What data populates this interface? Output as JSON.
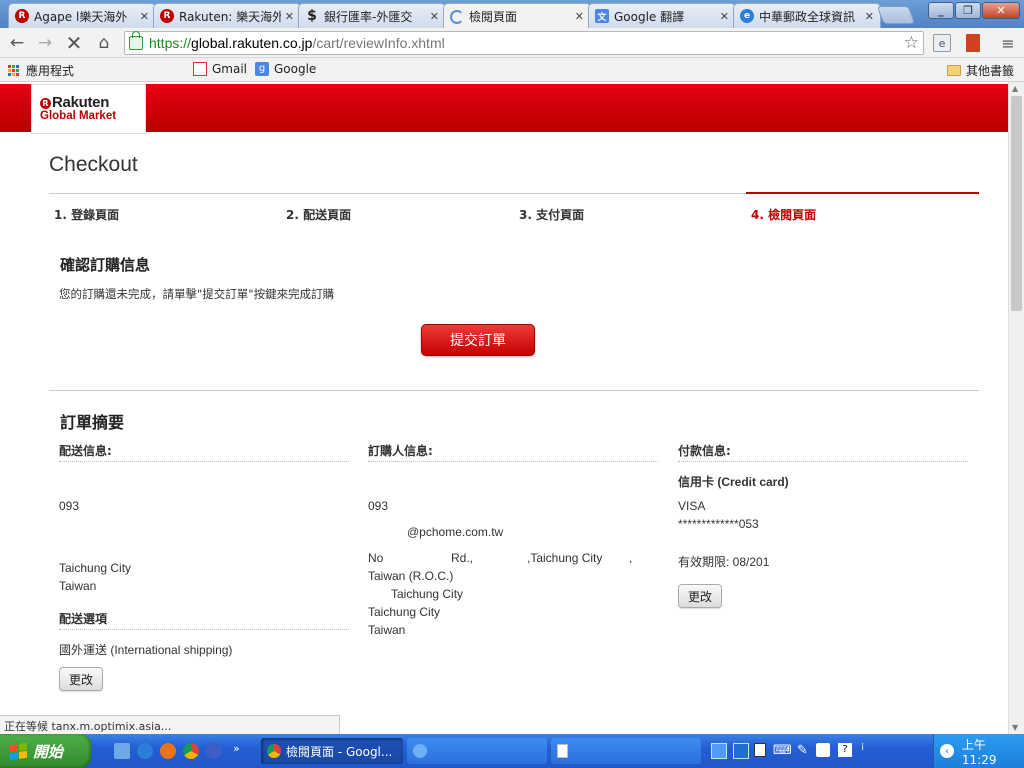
{
  "browser": {
    "tabs": [
      {
        "title": "Agape l樂天海外",
        "favicon": "rakuten-icon",
        "active": false
      },
      {
        "title": "Rakuten: 樂天海外",
        "favicon": "rakuten-icon",
        "active": false
      },
      {
        "title": "銀行匯率-外匯交",
        "favicon": "dollar-icon",
        "active": false
      },
      {
        "title": "檢閱頁面",
        "favicon": "loading-icon",
        "active": true
      },
      {
        "title": "Google 翻譯",
        "favicon": "google-translate-icon",
        "active": false
      },
      {
        "title": "中華郵政全球資訊",
        "favicon": "ie-icon",
        "active": false
      }
    ],
    "url": {
      "scheme": "https://",
      "host": "global.rakuten.co.jp",
      "path": "/cart/reviewInfo.xhtml"
    },
    "bookmarks": {
      "apps": "應用程式",
      "gmail": "Gmail",
      "google": "Google",
      "other": "其他書籤"
    },
    "status": "正在等候 tanx.m.optimix.asia..."
  },
  "page": {
    "logo": {
      "main": "Rakuten",
      "sub": "Global Market"
    },
    "title": "Checkout",
    "steps": [
      {
        "label": "1. 登錄頁面",
        "active": false
      },
      {
        "label": "2. 配送頁面",
        "active": false
      },
      {
        "label": "3. 支付頁面",
        "active": false
      },
      {
        "label": "4. 檢閱頁面",
        "active": true
      }
    ],
    "confirm": {
      "title": "確認訂購信息",
      "note": "您的訂購還未完成，請單擊\"提交訂單\"按鍵來完成訂購",
      "submit_label": "提交訂單"
    },
    "summary": {
      "title": "訂單摘要",
      "shipping": {
        "header": "配送信息:",
        "phone": "093",
        "city": "Taichung City",
        "country": "Taiwan",
        "option_header": "配送選項",
        "option_value": "國外運送 (International shipping)",
        "change_label": "更改"
      },
      "buyer": {
        "header": "訂購人信息:",
        "phone": "093",
        "email": "@pchome.com.tw",
        "address_no": "No",
        "address_rd": "Rd.,",
        "address_city": ",Taichung City",
        "address_comma": ",",
        "address_roc": "Taiwan (R.O.C.)",
        "city_1": "Taichung City",
        "city_2": "Taichung City",
        "country": "Taiwan"
      },
      "payment": {
        "header": "付款信息:",
        "method": "信用卡 (Credit card)",
        "brand": "VISA",
        "card_number": "*************053",
        "expiry": "有效期限: 08/201",
        "change_label": "更改"
      }
    }
  },
  "taskbar": {
    "start_label": "開始",
    "windows": [
      {
        "title": "檢閱頁面 - Googl...",
        "icon": "chrome-icon"
      },
      {
        "title": "",
        "icon": "ie-icon"
      },
      {
        "title": "",
        "icon": "document-icon"
      }
    ],
    "clock": "上午 11:29"
  },
  "colors": {
    "brand_red": "#bf0000",
    "header_red": "#e60012",
    "active_step": "#bf0000",
    "link_green": "#1e8a1e",
    "taskbar_blue": "#245ed4"
  }
}
